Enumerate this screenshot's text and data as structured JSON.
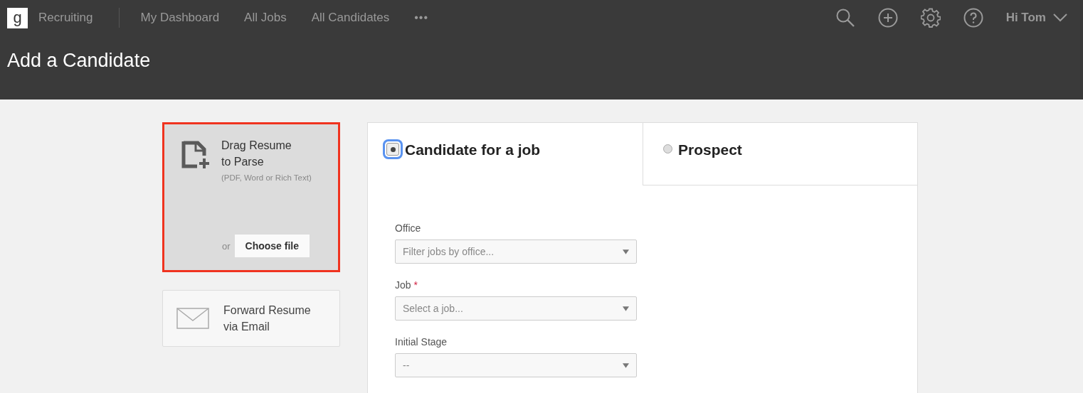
{
  "topbar": {
    "logo": "g",
    "app_name": "Recruiting",
    "nav": [
      {
        "label": "My Dashboard"
      },
      {
        "label": "All Jobs"
      },
      {
        "label": "All Candidates"
      }
    ],
    "more": "•••",
    "greeting": "Hi Tom"
  },
  "page_title": "Add a Candidate",
  "upload": {
    "title_lines": [
      "Drag Resume",
      "to Parse"
    ],
    "hint": "(PDF, Word or Rich Text)",
    "or": "or",
    "button": "Choose file",
    "highlighted": true
  },
  "email_option": {
    "lines": [
      "Forward Resume",
      "via Email"
    ]
  },
  "type_tabs": [
    {
      "label": "Candidate for a job",
      "selected": true
    },
    {
      "label": "Prospect",
      "selected": false
    }
  ],
  "fields": [
    {
      "label": "Office",
      "placeholder": "Filter jobs by office..."
    },
    {
      "label": "Job",
      "required_mark": "*",
      "placeholder": "Select a job..."
    },
    {
      "label": "Initial Stage",
      "placeholder": "--"
    }
  ]
}
